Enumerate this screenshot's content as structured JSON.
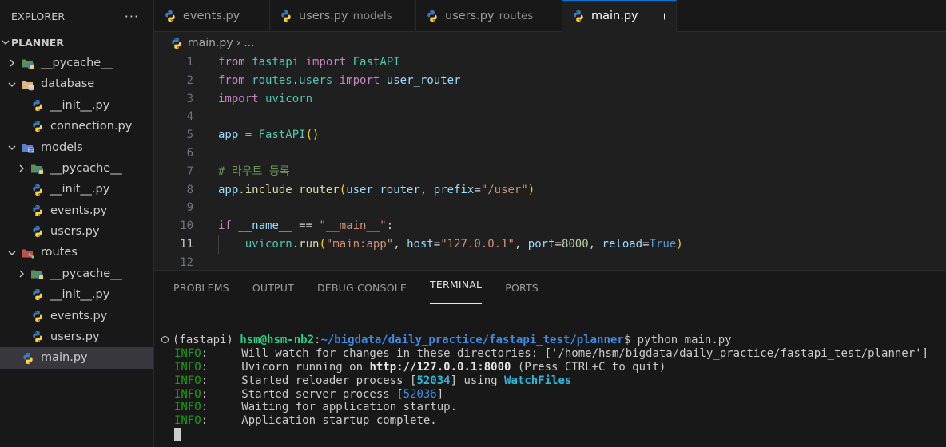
{
  "sidebar": {
    "header": "EXPLORER",
    "more": "···",
    "section": "PLANNER",
    "tree": [
      {
        "label": "__pycache__",
        "type": "folder",
        "icon": "pycache-folder-icon",
        "depth": 0,
        "expanded": false
      },
      {
        "label": "database",
        "type": "folder",
        "icon": "database-folder-icon",
        "depth": 0,
        "expanded": true
      },
      {
        "label": "__init__.py",
        "type": "file",
        "icon": "python-icon",
        "depth": 1
      },
      {
        "label": "connection.py",
        "type": "file",
        "icon": "python-icon",
        "depth": 1
      },
      {
        "label": "models",
        "type": "folder",
        "icon": "models-folder-icon",
        "depth": 0,
        "expanded": true
      },
      {
        "label": "__pycache__",
        "type": "folder",
        "icon": "pycache-folder-icon",
        "depth": 1,
        "expanded": false
      },
      {
        "label": "__init__.py",
        "type": "file",
        "icon": "python-icon",
        "depth": 1
      },
      {
        "label": "events.py",
        "type": "file",
        "icon": "python-icon",
        "depth": 1
      },
      {
        "label": "users.py",
        "type": "file",
        "icon": "python-icon",
        "depth": 1
      },
      {
        "label": "routes",
        "type": "folder",
        "icon": "routes-folder-icon",
        "depth": 0,
        "expanded": true
      },
      {
        "label": "__pycache__",
        "type": "folder",
        "icon": "pycache-folder-icon",
        "depth": 1,
        "expanded": false
      },
      {
        "label": "__init__.py",
        "type": "file",
        "icon": "python-icon",
        "depth": 1
      },
      {
        "label": "events.py",
        "type": "file",
        "icon": "python-icon",
        "depth": 1
      },
      {
        "label": "users.py",
        "type": "file",
        "icon": "python-icon",
        "depth": 1
      },
      {
        "label": "main.py",
        "type": "file",
        "icon": "python-icon",
        "depth": 0,
        "selected": true
      }
    ]
  },
  "tabs": [
    {
      "label": "events.py",
      "desc": ""
    },
    {
      "label": "users.py",
      "desc": "models"
    },
    {
      "label": "users.py",
      "desc": "routes"
    },
    {
      "label": "main.py",
      "desc": "",
      "active": true,
      "modified": true
    }
  ],
  "breadcrumb": {
    "file": "main.py",
    "sep": "›",
    "rest": "..."
  },
  "code": {
    "line_numbers": [
      "1",
      "2",
      "3",
      "4",
      "5",
      "6",
      "7",
      "8",
      "9",
      "10",
      "11",
      "12"
    ],
    "current_line": 11,
    "tokens": [
      [
        [
          "kw",
          "from"
        ],
        [
          "op",
          " "
        ],
        [
          "mod",
          "fastapi"
        ],
        [
          "op",
          " "
        ],
        [
          "kw",
          "import"
        ],
        [
          "op",
          " "
        ],
        [
          "cls",
          "FastAPI"
        ]
      ],
      [
        [
          "kw",
          "from"
        ],
        [
          "op",
          " "
        ],
        [
          "mod",
          "routes"
        ],
        [
          "op",
          "."
        ],
        [
          "mod",
          "users"
        ],
        [
          "op",
          " "
        ],
        [
          "kw",
          "import"
        ],
        [
          "op",
          " "
        ],
        [
          "var",
          "user_router"
        ]
      ],
      [
        [
          "kw",
          "import"
        ],
        [
          "op",
          " "
        ],
        [
          "mod",
          "uvicorn"
        ]
      ],
      [],
      [
        [
          "var",
          "app"
        ],
        [
          "op",
          " = "
        ],
        [
          "cls",
          "FastAPI"
        ],
        [
          "paren",
          "()"
        ]
      ],
      [],
      [
        [
          "cmt",
          "# 라우트 등록"
        ]
      ],
      [
        [
          "var",
          "app"
        ],
        [
          "op",
          "."
        ],
        [
          "fn",
          "include_router"
        ],
        [
          "paren",
          "("
        ],
        [
          "var",
          "user_router"
        ],
        [
          "op",
          ", "
        ],
        [
          "var",
          "prefix"
        ],
        [
          "op",
          "="
        ],
        [
          "str",
          "\"/user\""
        ],
        [
          "paren",
          ")"
        ]
      ],
      [],
      [
        [
          "kw",
          "if"
        ],
        [
          "op",
          " "
        ],
        [
          "var",
          "__name__"
        ],
        [
          "op",
          " == "
        ],
        [
          "str",
          "\"__main__\""
        ],
        [
          "op",
          ":"
        ]
      ],
      [
        [
          "op",
          "    "
        ],
        [
          "mod",
          "uvicorn"
        ],
        [
          "op",
          "."
        ],
        [
          "fn",
          "run"
        ],
        [
          "paren",
          "("
        ],
        [
          "str",
          "\"main:app\""
        ],
        [
          "op",
          ", "
        ],
        [
          "var",
          "host"
        ],
        [
          "op",
          "="
        ],
        [
          "str",
          "\"127.0.0.1\""
        ],
        [
          "op",
          ", "
        ],
        [
          "var",
          "port"
        ],
        [
          "op",
          "="
        ],
        [
          "num",
          "8000"
        ],
        [
          "op",
          ", "
        ],
        [
          "var",
          "reload"
        ],
        [
          "op",
          "="
        ],
        [
          "bool",
          "True"
        ],
        [
          "paren",
          ")"
        ]
      ],
      []
    ]
  },
  "panel": {
    "tabs": [
      "PROBLEMS",
      "OUTPUT",
      "DEBUG CONSOLE",
      "TERMINAL",
      "PORTS"
    ],
    "active_tab": "TERMINAL"
  },
  "terminal": {
    "env": "(fastapi)",
    "user_host": "hsm@hsm-nb2",
    "colon": ":",
    "cwd": "~/bigdata/daily_practice/fastapi_test/planner",
    "prompt_end": "$ ",
    "command": "python main.py",
    "lines": [
      [
        [
          "green",
          "INFO"
        ],
        [
          "plain",
          ":     Will watch for changes in these directories: ['/home/hsm/bigdata/daily_practice/fastapi_test/planner']"
        ]
      ],
      [
        [
          "green",
          "INFO"
        ],
        [
          "plain",
          ":     Uvicorn running on "
        ],
        [
          "bold",
          "http://127.0.0.1:8000"
        ],
        [
          "plain",
          " (Press CTRL+C to quit)"
        ]
      ],
      [
        [
          "green",
          "INFO"
        ],
        [
          "plain",
          ":     Started reloader process ["
        ],
        [
          "cyanb",
          "52034"
        ],
        [
          "plain",
          "] using "
        ],
        [
          "cyanb",
          "WatchFiles"
        ]
      ],
      [
        [
          "green",
          "INFO"
        ],
        [
          "plain",
          ":     Started server process ["
        ],
        [
          "blue",
          "52036"
        ],
        [
          "plain",
          "]"
        ]
      ],
      [
        [
          "green",
          "INFO"
        ],
        [
          "plain",
          ":     Waiting for application startup."
        ]
      ],
      [
        [
          "green",
          "INFO"
        ],
        [
          "plain",
          ":     Application startup complete."
        ]
      ]
    ]
  },
  "colors": {
    "accent": "#0078d4",
    "editor_bg": "#1f1f1f",
    "sidebar_bg": "#181818",
    "selected_row": "#37373d"
  }
}
